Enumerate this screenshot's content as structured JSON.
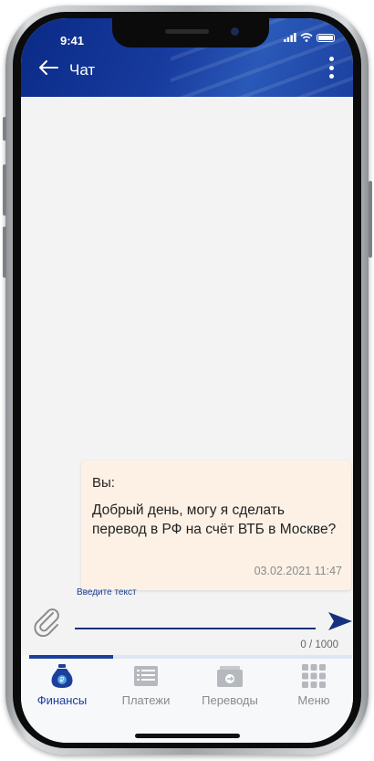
{
  "status_bar": {
    "time": "9:41"
  },
  "header": {
    "back_icon": "arrow-left-icon",
    "title": "Чат",
    "menu_icon": "kebab-menu-icon"
  },
  "message": {
    "sender": "Вы:",
    "text": "Добрый день, могу я сделать перевод в РФ на счёт ВТБ в Москве?",
    "timestamp": "03.02.2021 11:47"
  },
  "composer": {
    "label": "Введите текст",
    "value": "",
    "counter": "0 / 1000",
    "attach_icon": "paperclip-icon",
    "send_icon": "send-arrow-icon"
  },
  "progress": {
    "value": 0.26
  },
  "tabs": [
    {
      "label": "Финансы",
      "icon": "money-bag-icon",
      "active": true
    },
    {
      "label": "Платежи",
      "icon": "list-icon",
      "active": false
    },
    {
      "label": "Переводы",
      "icon": "wallet-transfer-icon",
      "active": false
    },
    {
      "label": "Меню",
      "icon": "grid-icon",
      "active": false
    }
  ],
  "colors": {
    "primary": "#1c3f9e",
    "header_dark": "#0a2a86",
    "bubble": "#fdf1e6",
    "inactive": "#8a8a8a"
  }
}
